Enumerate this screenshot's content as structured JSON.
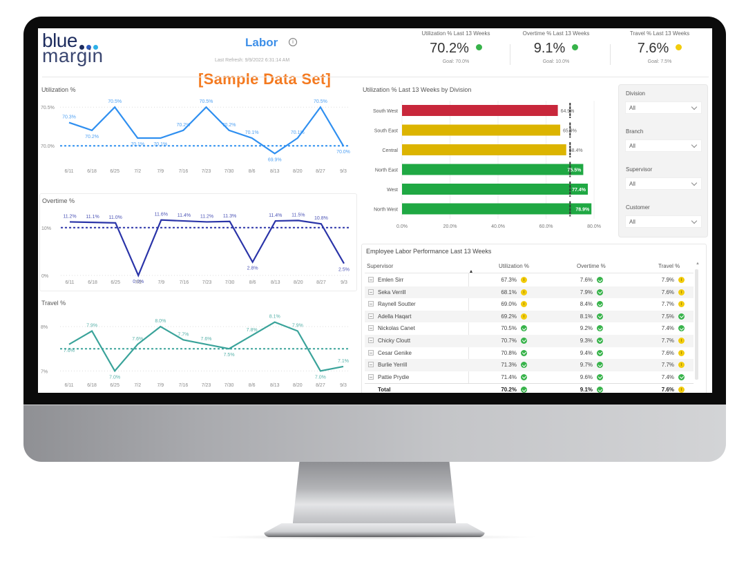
{
  "header": {
    "logo_line1": "blue",
    "logo_line2": "margin",
    "logo_dot_colors": [
      "#1d2c5e",
      "#2f5bbd",
      "#2cb0e8"
    ],
    "title": "Labor",
    "info_icon": "info-circle-icon",
    "last_refresh": "Last Refresh: 9/9/2022 6:31:14 AM",
    "banner": "[Sample Data Set]"
  },
  "kpis": [
    {
      "label": "Utilization % Last 13 Weeks",
      "value": "70.2%",
      "status": "green",
      "goal": "Goal: 70.0%"
    },
    {
      "label": "Overtime % Last 13 Weeks",
      "value": "9.1%",
      "status": "green",
      "goal": "Goal: 10.0%"
    },
    {
      "label": "Travel % Last 13 Weeks",
      "value": "7.6%",
      "status": "yellow",
      "goal": "Goal: 7.5%"
    }
  ],
  "colors": {
    "utilization_line": "#2f8ff0",
    "overtime_line": "#2a34a8",
    "travel_line": "#3aa39a",
    "bar_red": "#c8273b",
    "bar_yellow": "#dcb400",
    "bar_green": "#1fa843",
    "status_green": "#37b34a",
    "status_yellow": "#f2cc0c",
    "banner": "#f47a20",
    "title": "#3d8fe8"
  },
  "chart_data": [
    {
      "type": "line",
      "title": "Utilization %",
      "x": [
        "6/11",
        "6/18",
        "6/25",
        "7/2",
        "7/9",
        "7/16",
        "7/23",
        "7/30",
        "8/6",
        "8/13",
        "8/20",
        "8/27",
        "9/3"
      ],
      "values": [
        70.3,
        70.2,
        70.5,
        70.1,
        70.1,
        70.2,
        70.5,
        70.2,
        70.1,
        69.9,
        70.1,
        70.5,
        70.0
      ],
      "labels": [
        "70.3%",
        "70.2%",
        "70.5%",
        "70.1%",
        "70.1%",
        "70.2%",
        "70.5%",
        "70.2%",
        "70.1%",
        "69.9%",
        "70.1%",
        "70.5%",
        "70.0%"
      ],
      "goal": 70.0,
      "yticks": [
        70.0,
        70.5
      ],
      "ytick_labels": [
        "70.0%",
        "70.5%"
      ],
      "ylim": [
        69.85,
        70.6
      ]
    },
    {
      "type": "line",
      "title": "Overtime %",
      "x": [
        "6/11",
        "6/18",
        "6/25",
        "7/2",
        "7/9",
        "7/16",
        "7/23",
        "7/30",
        "8/6",
        "8/13",
        "8/20",
        "8/27",
        "9/3"
      ],
      "values": [
        11.2,
        11.1,
        11.0,
        0.0,
        11.6,
        11.4,
        11.2,
        11.3,
        2.8,
        11.4,
        11.5,
        10.8,
        2.5
      ],
      "labels": [
        "11.2%",
        "11.1%",
        "11.0%",
        "0.0%",
        "11.6%",
        "11.4%",
        "11.2%",
        "11.3%",
        "2.8%",
        "11.4%",
        "11.5%",
        "10.8%",
        "2.5%"
      ],
      "goal": 10.0,
      "yticks": [
        0,
        10
      ],
      "ytick_labels": [
        "0%",
        "10%"
      ],
      "ylim": [
        0,
        13
      ]
    },
    {
      "type": "line",
      "title": "Travel %",
      "x": [
        "6/11",
        "6/18",
        "6/25",
        "7/2",
        "7/9",
        "7/16",
        "7/23",
        "7/30",
        "8/6",
        "8/13",
        "8/20",
        "8/27",
        "9/3"
      ],
      "values": [
        7.6,
        7.9,
        7.0,
        7.6,
        8.0,
        7.7,
        7.6,
        7.5,
        7.8,
        8.1,
        7.9,
        7.0,
        7.1
      ],
      "labels": [
        "7.6%",
        "7.9%",
        "7.0%",
        "7.6%",
        "8.0%",
        "7.7%",
        "7.6%",
        "7.5%",
        "7.8%",
        "8.1%",
        "7.9%",
        "7.0%",
        "7.1%"
      ],
      "goal": 7.5,
      "yticks": [
        7,
        8
      ],
      "ytick_labels": [
        "7%",
        "8%"
      ],
      "ylim": [
        6.85,
        8.25
      ]
    },
    {
      "type": "bar",
      "orientation": "horizontal",
      "title": "Utilization % Last 13 Weeks by Division",
      "categories": [
        "South West",
        "South East",
        "Central",
        "North East",
        "West",
        "North West"
      ],
      "values": [
        64.9,
        65.9,
        68.4,
        75.5,
        77.4,
        78.9
      ],
      "labels": [
        "64.9%",
        "65.9%",
        "68.4%",
        "75.5%",
        "77.4%",
        "78.9%"
      ],
      "status": [
        "red",
        "yellow",
        "yellow",
        "green",
        "green",
        "green"
      ],
      "goal": 70.0,
      "xticks": [
        0,
        20,
        40,
        60,
        80
      ],
      "xtick_labels": [
        "0.0%",
        "20.0%",
        "40.0%",
        "60.0%",
        "80.0%"
      ],
      "xlim": [
        0,
        82
      ]
    }
  ],
  "filters": [
    {
      "label": "Division",
      "value": "All"
    },
    {
      "label": "Branch",
      "value": "All"
    },
    {
      "label": "Supervisor",
      "value": "All"
    },
    {
      "label": "Customer",
      "value": "All"
    }
  ],
  "table": {
    "title": "Employee Labor Performance Last 13 Weeks",
    "columns": [
      "Supervisor",
      "Utilization %",
      "Overtime %",
      "Travel %"
    ],
    "rows": [
      {
        "name": "Emlen Sirr",
        "util": "67.3%",
        "util_s": "yellow",
        "ot": "7.6%",
        "ot_s": "green",
        "travel": "7.9%",
        "travel_s": "yellow"
      },
      {
        "name": "Seka Verrill",
        "util": "68.1%",
        "util_s": "yellow",
        "ot": "7.9%",
        "ot_s": "green",
        "travel": "7.6%",
        "travel_s": "yellow"
      },
      {
        "name": "Raynell Soutter",
        "util": "69.0%",
        "util_s": "yellow",
        "ot": "8.4%",
        "ot_s": "green",
        "travel": "7.7%",
        "travel_s": "yellow"
      },
      {
        "name": "Adella Haqart",
        "util": "69.2%",
        "util_s": "yellow",
        "ot": "8.1%",
        "ot_s": "green",
        "travel": "7.5%",
        "travel_s": "green"
      },
      {
        "name": "Nickolas Canet",
        "util": "70.5%",
        "util_s": "green",
        "ot": "9.2%",
        "ot_s": "green",
        "travel": "7.4%",
        "travel_s": "green"
      },
      {
        "name": "Chicky Cloutt",
        "util": "70.7%",
        "util_s": "green",
        "ot": "9.3%",
        "ot_s": "green",
        "travel": "7.7%",
        "travel_s": "yellow"
      },
      {
        "name": "Cesar Genike",
        "util": "70.8%",
        "util_s": "green",
        "ot": "9.4%",
        "ot_s": "green",
        "travel": "7.6%",
        "travel_s": "yellow"
      },
      {
        "name": "Burlie Yerrill",
        "util": "71.3%",
        "util_s": "green",
        "ot": "9.7%",
        "ot_s": "green",
        "travel": "7.7%",
        "travel_s": "yellow"
      },
      {
        "name": "Pattie Prydie",
        "util": "71.4%",
        "util_s": "green",
        "ot": "9.6%",
        "ot_s": "green",
        "travel": "7.4%",
        "travel_s": "green"
      }
    ],
    "total": {
      "name": "Total",
      "util": "70.2%",
      "util_s": "green",
      "ot": "9.1%",
      "ot_s": "green",
      "travel": "7.6%",
      "travel_s": "yellow"
    }
  }
}
